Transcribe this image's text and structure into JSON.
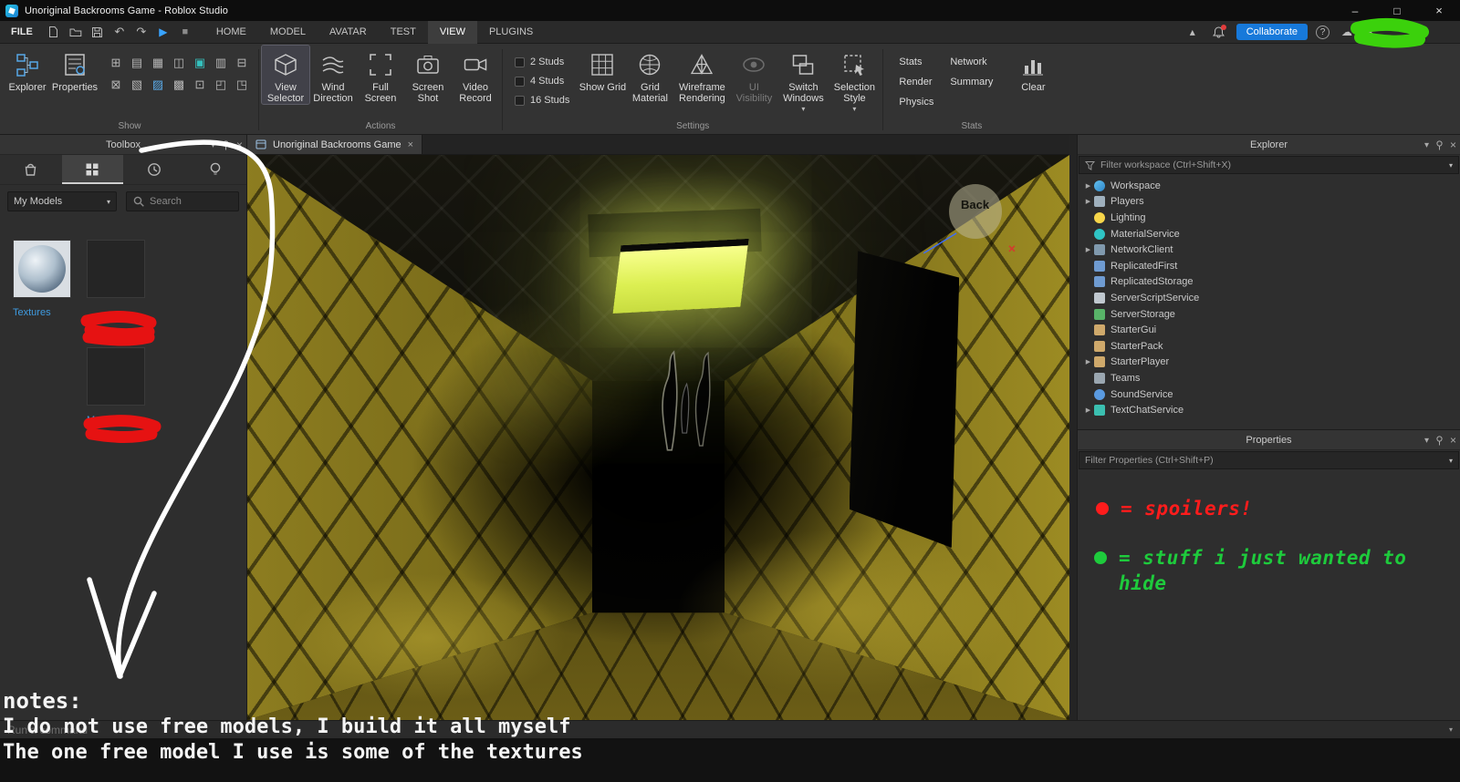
{
  "window": {
    "title": "Unoriginal Backrooms Game - Roblox Studio"
  },
  "menubar": {
    "file": "FILE",
    "tabs": [
      "HOME",
      "MODEL",
      "AVATAR",
      "TEST",
      "VIEW",
      "PLUGINS"
    ],
    "active_tab": "VIEW",
    "collaborate": "Collaborate"
  },
  "ribbon": {
    "explorer": "Explorer",
    "properties": "Properties",
    "groups": {
      "show": "Show",
      "actions": "Actions",
      "settings": "Settings",
      "stats": "Stats"
    },
    "view_selector": "View Selector",
    "wind_direction": "Wind Direction",
    "full_screen": "Full Screen",
    "screen_shot": "Screen Shot",
    "video_record": "Video Record",
    "studs": [
      "2 Studs",
      "4 Studs",
      "16 Studs"
    ],
    "show_grid": "Show Grid",
    "grid_material": "Grid Material",
    "wireframe_rendering": "Wireframe Rendering",
    "ui_visibility": "UI Visibility",
    "switch_windows": "Switch Windows",
    "selection_style": "Selection Style",
    "stats_items": [
      "Stats",
      "Network",
      "Render",
      "Summary",
      "Physics"
    ],
    "clear": "Clear",
    "show_icon_glyphs": [
      "⊞",
      "▤",
      "▦",
      "◫",
      "▣",
      "▥",
      "⊟",
      "⊠",
      "▧",
      "▨",
      "▩",
      "⊡",
      "◰",
      "◳"
    ]
  },
  "toolbox": {
    "title": "Toolbox",
    "category": "My Models",
    "search_placeholder": "Search",
    "items": [
      {
        "label": "Textures"
      },
      {
        "label": ""
      },
      {
        "line1": "M",
        "line2": "Kit"
      }
    ]
  },
  "viewport": {
    "tab": "Unoriginal Backrooms Game",
    "back_label": "Back"
  },
  "explorer": {
    "title": "Explorer",
    "filter": "Filter workspace (Ctrl+Shift+X)",
    "items": [
      {
        "label": "Workspace"
      },
      {
        "label": "Players"
      },
      {
        "label": "Lighting"
      },
      {
        "label": "MaterialService"
      },
      {
        "label": "NetworkClient"
      },
      {
        "label": "ReplicatedFirst"
      },
      {
        "label": "ReplicatedStorage"
      },
      {
        "label": "ServerScriptService"
      },
      {
        "label": "ServerStorage"
      },
      {
        "label": "StarterGui"
      },
      {
        "label": "StarterPack"
      },
      {
        "label": "StarterPlayer"
      },
      {
        "label": "Teams"
      },
      {
        "label": "SoundService"
      },
      {
        "label": "TextChatService"
      }
    ]
  },
  "properties": {
    "title": "Properties",
    "filter": "Filter Properties (Ctrl+Shift+P)",
    "annotations": {
      "spoilers": "= spoilers!",
      "hidden": "= stuff i just wanted to hide"
    }
  },
  "command_bar": {
    "placeholder": "Run a command"
  },
  "notes": {
    "line1": "notes:",
    "line2": "I do not use free models, I build it all myself",
    "line3": "The one free model I use is some of the textures"
  },
  "colors": {
    "accent_blue": "#38a3ff",
    "collaborate_blue": "#1779da",
    "spoiler_red": "#ff1c1c",
    "hide_green": "#1ecb3c",
    "link_blue": "#3f9be0"
  }
}
